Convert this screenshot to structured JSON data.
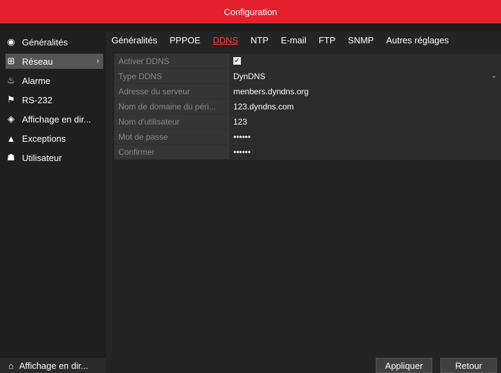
{
  "title": "Configuration",
  "sidebar": {
    "items": [
      {
        "label": "Généralités",
        "icon": "settings-circle-icon",
        "glyph": "◉"
      },
      {
        "label": "Réseau",
        "icon": "network-icon",
        "glyph": "⊞",
        "arrow": "›"
      },
      {
        "label": "Alarme",
        "icon": "alarm-icon",
        "glyph": "♨"
      },
      {
        "label": "RS-232",
        "icon": "serial-icon",
        "glyph": "⚑"
      },
      {
        "label": "Affichage en dir...",
        "icon": "eye-icon",
        "glyph": "◈"
      },
      {
        "label": "Exceptions",
        "icon": "warning-icon",
        "glyph": "▲"
      },
      {
        "label": "Utilisateur",
        "icon": "users-icon",
        "glyph": "☗"
      }
    ],
    "bottom": {
      "label": "Affichage en dir...",
      "icon": "home-icon",
      "glyph": "⌂"
    }
  },
  "tabs": [
    "Généralités",
    "PPPOE",
    "DDNS",
    "NTP",
    "E-mail",
    "FTP",
    "SNMP",
    "Autres réglages"
  ],
  "form": {
    "rows": [
      {
        "label": "Activer DDNS",
        "value": "",
        "checked": "✓"
      },
      {
        "label": "Type DDNS",
        "value": "DynDNS",
        "caret": "⌄"
      },
      {
        "label": "Adresse du serveur",
        "value": "menbers.dyndns.org"
      },
      {
        "label": "Nom de domaine du péri...",
        "value": "123.dyndns.com"
      },
      {
        "label": "Nom d'utilisateur",
        "value": "123"
      },
      {
        "label": "Mot de passe",
        "value": "••••••"
      },
      {
        "label": "Confirmer",
        "value": "••••••"
      }
    ]
  },
  "buttons": {
    "apply": "Appliquer",
    "back": "Retour"
  },
  "colors": {
    "accent": "#e5202e",
    "active_tab": "#ff3a3a"
  }
}
